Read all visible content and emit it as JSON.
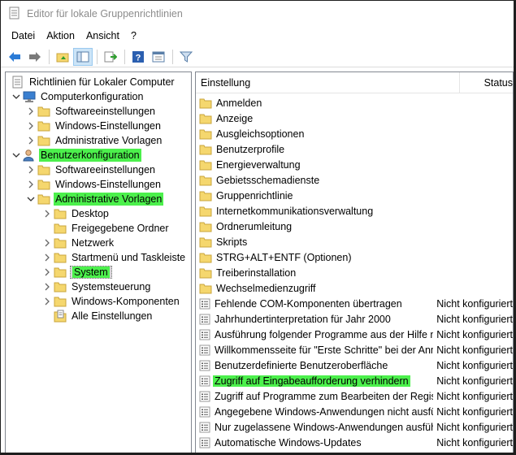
{
  "window": {
    "title": "Editor für lokale Gruppenrichtlinien"
  },
  "menu": {
    "items": [
      "Datei",
      "Aktion",
      "Ansicht",
      "?"
    ]
  },
  "tree": {
    "root": "Richtlinien für Lokaler Computer",
    "computer": {
      "label": "Computerkonfiguration",
      "children": [
        "Softwareeinstellungen",
        "Windows-Einstellungen",
        "Administrative Vorlagen"
      ]
    },
    "user": {
      "label": "Benutzerkonfiguration",
      "children": [
        "Softwareeinstellungen",
        "Windows-Einstellungen",
        "Administrative Vorlagen"
      ],
      "admin_children": [
        "Desktop",
        "Freigegebene Ordner",
        "Netzwerk",
        "Startmenü und Taskleiste",
        "System",
        "Systemsteuerung",
        "Windows-Komponenten",
        "Alle Einstellungen"
      ]
    }
  },
  "list": {
    "columns": [
      "Einstellung",
      "Status"
    ],
    "folders": [
      "Anmelden",
      "Anzeige",
      "Ausgleichsoptionen",
      "Benutzerprofile",
      "Energieverwaltung",
      "Gebietsschemadienste",
      "Gruppenrichtlinie",
      "Internetkommunikationsverwaltung",
      "Ordnerumleitung",
      "Skripts",
      "STRG+ALT+ENTF (Optionen)",
      "Treiberinstallation",
      "Wechselmedienzugriff"
    ],
    "settings": [
      {
        "name": "Fehlende COM-Komponenten übertragen",
        "state": "Nicht konfiguriert"
      },
      {
        "name": "Jahrhundertinterpretation für Jahr 2000",
        "state": "Nicht konfiguriert"
      },
      {
        "name": "Ausführung folgender Programme aus der Hilfe nicht zulass...",
        "state": "Nicht konfiguriert"
      },
      {
        "name": "Willkommensseite für \"Erste Schritte\" bei der Anmeldung ni...",
        "state": "Nicht konfiguriert"
      },
      {
        "name": "Benutzerdefinierte Benutzeroberfläche",
        "state": "Nicht konfiguriert"
      },
      {
        "name": "Zugriff auf Eingabeaufforderung verhindern",
        "state": "Nicht konfiguriert"
      },
      {
        "name": "Zugriff auf Programme zum Bearbeiten der Registrierung ve...",
        "state": "Nicht konfiguriert"
      },
      {
        "name": "Angegebene Windows-Anwendungen nicht ausführen",
        "state": "Nicht konfiguriert"
      },
      {
        "name": "Nur zugelassene Windows-Anwendungen ausführen",
        "state": "Nicht konfiguriert"
      },
      {
        "name": "Automatische Windows-Updates",
        "state": "Nicht konfiguriert"
      }
    ]
  },
  "colors": {
    "highlight": "#4cf04c",
    "folder": "#f5d76e",
    "accent": "#2b7bd6"
  }
}
